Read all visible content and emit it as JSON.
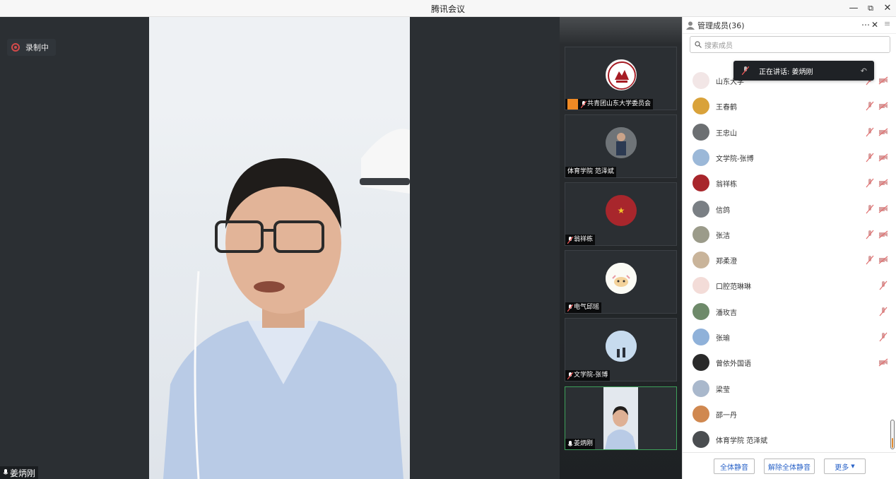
{
  "window": {
    "title": "腾讯会议"
  },
  "recording": {
    "label": "录制中"
  },
  "main_speaker": {
    "name": "姜炳刚"
  },
  "tiles": [
    {
      "name": "共青团山东大学委员会"
    },
    {
      "name": "体育学院 范泽斌"
    },
    {
      "name": "翁祥栋"
    },
    {
      "name": "电气邱瑶"
    },
    {
      "name": "文学院-张博"
    },
    {
      "name": "姜炳刚"
    }
  ],
  "panel": {
    "title": "管理成员(36)",
    "search_placeholder": "搜索成员",
    "speaking_toast": "正在讲话: 姜炳刚",
    "members": [
      {
        "name": "山东大学",
        "mic": "muted",
        "cam": "off"
      },
      {
        "name": "王春鹤",
        "mic": "muted",
        "cam": "off"
      },
      {
        "name": "王忠山",
        "mic": "muted",
        "cam": "off"
      },
      {
        "name": "文学院-张博",
        "mic": "muted",
        "cam": "off"
      },
      {
        "name": "翁祥栋",
        "mic": "muted",
        "cam": "off"
      },
      {
        "name": "信鸽",
        "mic": "muted",
        "cam": "off"
      },
      {
        "name": "张洁",
        "mic": "muted",
        "cam": "off"
      },
      {
        "name": "郑柔澄",
        "mic": "muted",
        "cam": "off"
      },
      {
        "name": "口腔范琳琳",
        "mic": "muted",
        "cam": ""
      },
      {
        "name": "潘玫吉",
        "mic": "muted",
        "cam": ""
      },
      {
        "name": "张瑜",
        "mic": "muted",
        "cam": ""
      },
      {
        "name": "曾依外国语",
        "mic": "",
        "cam": "off"
      },
      {
        "name": "梁莹",
        "mic": "",
        "cam": ""
      },
      {
        "name": "邵一丹",
        "mic": "",
        "cam": ""
      },
      {
        "name": "体育学院 范泽斌",
        "mic": "",
        "cam": ""
      }
    ],
    "buttons": {
      "mute_all": "全体静音",
      "unmute_all": "解除全体静音",
      "more": "更多"
    }
  },
  "colors": {
    "accent": "#2a63c8",
    "active_border": "#3ea05a",
    "record_red": "#d24a4a"
  }
}
